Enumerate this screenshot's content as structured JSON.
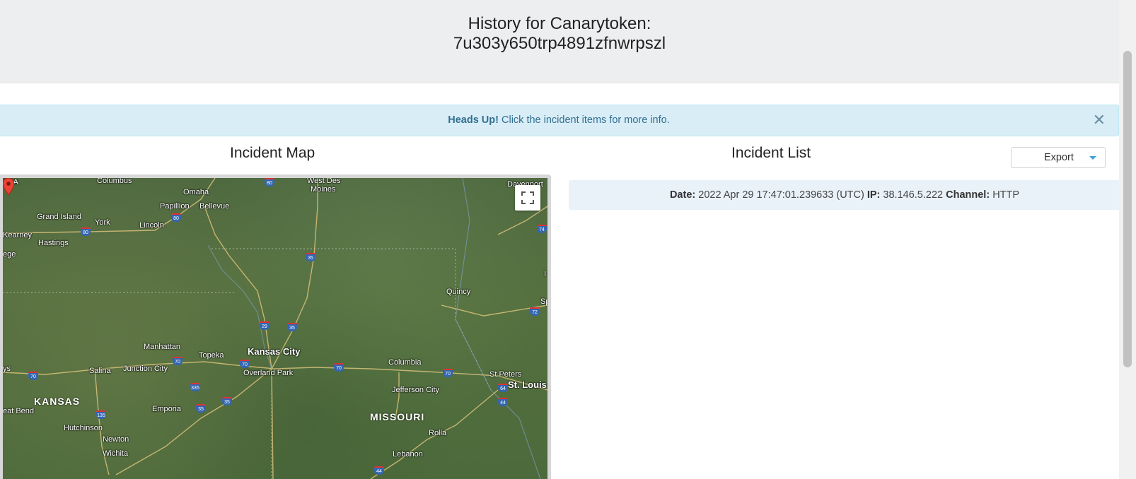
{
  "header": {
    "title_line1": "History for Canarytoken:",
    "title_line2": "7u303y650trp4891zfnwrpszl"
  },
  "alert": {
    "strong": "Heads Up!",
    "text": " Click the incident items for more info.",
    "close_symbol": "✕"
  },
  "map_section": {
    "heading": "Incident Map",
    "cities": [
      {
        "name": "SKA",
        "cls": "city"
      },
      {
        "name": "Columbus",
        "cls": "city"
      },
      {
        "name": "West Des",
        "cls": "city"
      },
      {
        "name": "Moines",
        "cls": "city"
      },
      {
        "name": "Davenport",
        "cls": "city"
      },
      {
        "name": "Omaha",
        "cls": "city"
      },
      {
        "name": "Papillion",
        "cls": "city"
      },
      {
        "name": "Bellevue",
        "cls": "city"
      },
      {
        "name": "Grand Island",
        "cls": "city"
      },
      {
        "name": "York",
        "cls": "city"
      },
      {
        "name": "Lincoln",
        "cls": "city"
      },
      {
        "name": "Kearney",
        "cls": "city"
      },
      {
        "name": "Hastings",
        "cls": "city"
      },
      {
        "name": "ege",
        "cls": "city"
      },
      {
        "name": "Quincy",
        "cls": "city"
      },
      {
        "name": "Sp",
        "cls": "city"
      },
      {
        "name": "Manhattan",
        "cls": "city"
      },
      {
        "name": "Topeka",
        "cls": "city"
      },
      {
        "name": "Kansas City",
        "cls": "city big"
      },
      {
        "name": "Overland Park",
        "cls": "city"
      },
      {
        "name": "Columbia",
        "cls": "city"
      },
      {
        "name": "ys",
        "cls": "city"
      },
      {
        "name": "Salina",
        "cls": "city"
      },
      {
        "name": "Junction City",
        "cls": "city"
      },
      {
        "name": "St Peters",
        "cls": "city"
      },
      {
        "name": "St. Louis",
        "cls": "city big"
      },
      {
        "name": "Jefferson City",
        "cls": "city"
      },
      {
        "name": "Emporia",
        "cls": "city"
      },
      {
        "name": "eat Bend",
        "cls": "city"
      },
      {
        "name": "Hutchinson",
        "cls": "city"
      },
      {
        "name": "Newton",
        "cls": "city"
      },
      {
        "name": "Wichita",
        "cls": "city"
      },
      {
        "name": "Rolla",
        "cls": "city"
      },
      {
        "name": "Lebanon",
        "cls": "city"
      },
      {
        "name": "I",
        "cls": "city"
      }
    ],
    "states": [
      "KANSAS",
      "MISSOURI"
    ],
    "highways": [
      "80",
      "80",
      "80",
      "74",
      "35",
      "72",
      "29",
      "35",
      "70",
      "70",
      "70",
      "70",
      "70",
      "335",
      "35",
      "35",
      "135",
      "64",
      "44",
      "44"
    ]
  },
  "list_section": {
    "heading": "Incident List",
    "export_label": "Export",
    "incidents": [
      {
        "date_label": "Date:",
        "date_value": "2022 Apr 29 17:47:01.239633 (UTC)",
        "ip_label": "IP:",
        "ip_value": "38.146.5.222",
        "channel_label": "Channel:",
        "channel_value": "HTTP"
      }
    ]
  }
}
